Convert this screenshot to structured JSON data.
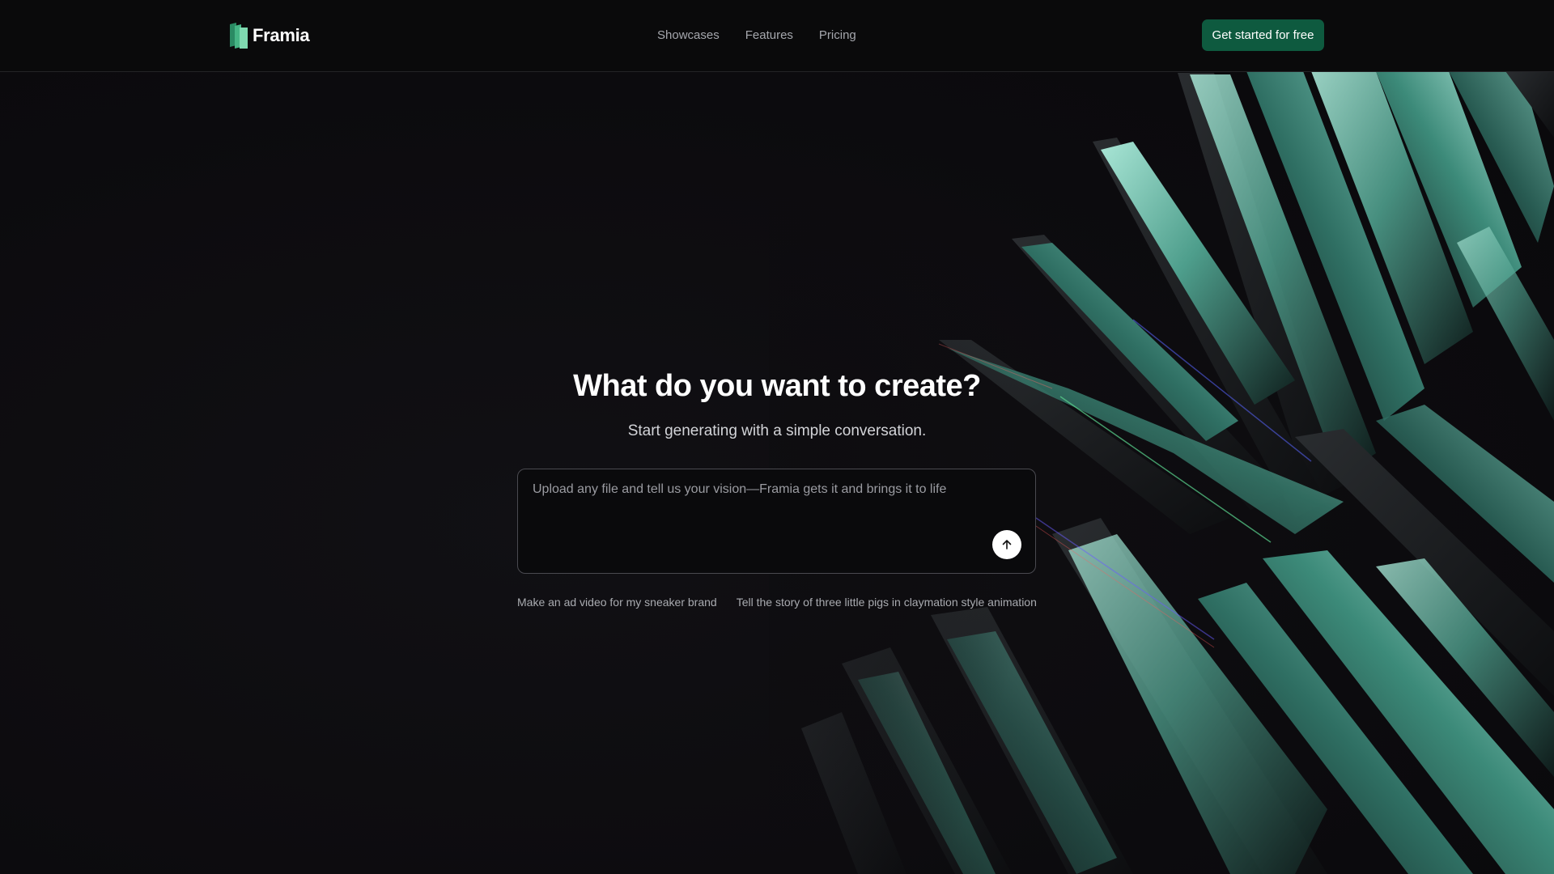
{
  "header": {
    "logo_text": "Framia",
    "nav": [
      {
        "label": "Showcases"
      },
      {
        "label": "Features"
      },
      {
        "label": "Pricing"
      }
    ],
    "cta_label": "Get started for free"
  },
  "hero": {
    "title": "What do you want to create?",
    "subtitle": "Start generating with a simple conversation.",
    "prompt": {
      "placeholder": "Upload any file and tell us your vision—Framia gets it and brings it to life",
      "value": ""
    },
    "send_icon": "arrow-up-icon",
    "suggestions": [
      {
        "label": "Make an ad video for my sneaker brand"
      },
      {
        "label": "Tell the story of three little pigs in claymation style animation"
      }
    ]
  },
  "colors": {
    "background": "#0c0b0e",
    "accent_green": "#0e5a3f",
    "logo_green_light": "#7fd9b0",
    "logo_green_dark": "#2a8a63",
    "art_teal": "#6fd0bb"
  }
}
